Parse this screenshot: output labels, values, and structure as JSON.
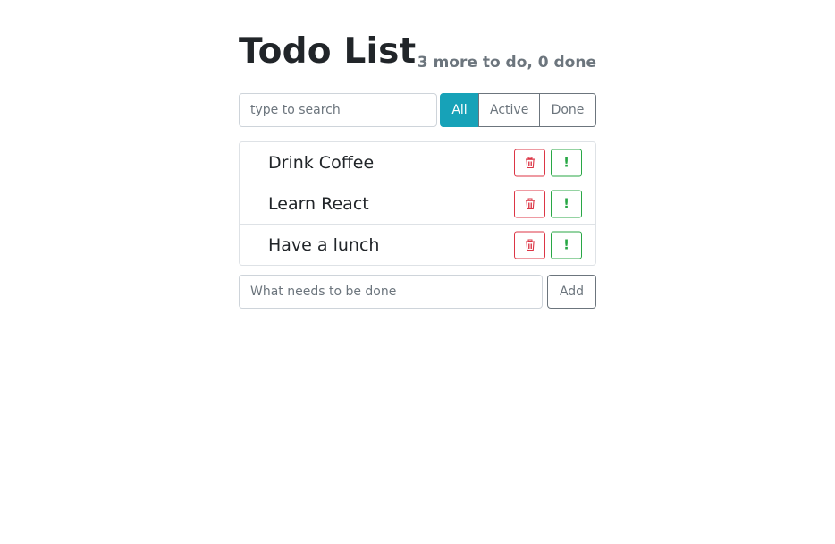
{
  "header": {
    "title": "Todo List",
    "status": "3 more to do, 0 done"
  },
  "search": {
    "placeholder": "type to search",
    "value": ""
  },
  "filters": [
    {
      "label": "All",
      "active": true
    },
    {
      "label": "Active",
      "active": false
    },
    {
      "label": "Done",
      "active": false
    }
  ],
  "todos": [
    {
      "label": "Drink Coffee",
      "delete_icon": "trash-icon",
      "important_icon": "exclamation-icon"
    },
    {
      "label": "Learn React",
      "delete_icon": "trash-icon",
      "important_icon": "exclamation-icon"
    },
    {
      "label": "Have a lunch",
      "delete_icon": "trash-icon",
      "important_icon": "exclamation-icon"
    }
  ],
  "add_form": {
    "placeholder": "What needs to be done",
    "value": "",
    "button_label": "Add"
  },
  "colors": {
    "accent": "#17a2b8",
    "danger": "#dc3545",
    "success": "#28a745",
    "muted": "#6c757d"
  }
}
